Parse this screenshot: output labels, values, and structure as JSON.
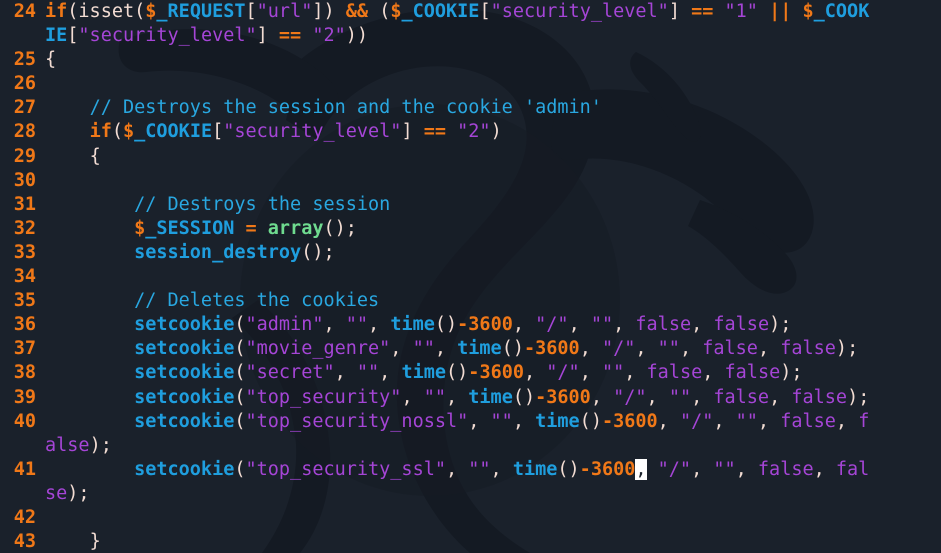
{
  "editor": {
    "name": "php-source-code-viewer",
    "language": "php",
    "background_color": "#1a212b",
    "line_number_color": "#f07818",
    "watermark": "kali-dragon-logo",
    "cursor": {
      "line": 41,
      "highlighted_char": ","
    }
  },
  "palette": {
    "keyword": "#f07818",
    "variable": "#1f9ede",
    "function": "#1f9ede",
    "function_builtin": "#6fdb8f",
    "string": "#a545d6",
    "number": "#f07818",
    "comment": "#29a7e0",
    "punctuation": "#f2dcd3",
    "boolean": "#a545d6",
    "cursor_bg": "#ffffff"
  },
  "lines": [
    {
      "number": "24",
      "tokens": [
        {
          "t": "if",
          "c": "kw"
        },
        {
          "t": "(",
          "c": "punc"
        },
        {
          "t": "isset",
          "c": "plain"
        },
        {
          "t": "(",
          "c": "punc"
        },
        {
          "t": "$",
          "c": "kw"
        },
        {
          "t": "_REQUEST",
          "c": "var"
        },
        {
          "t": "[",
          "c": "punc"
        },
        {
          "t": "\"url\"",
          "c": "str"
        },
        {
          "t": "]",
          "c": "punc"
        },
        {
          "t": ")",
          "c": "punc"
        },
        {
          "t": " ",
          "c": "plain"
        },
        {
          "t": "&&",
          "c": "op"
        },
        {
          "t": " ",
          "c": "plain"
        },
        {
          "t": "(",
          "c": "punc"
        },
        {
          "t": "$",
          "c": "kw"
        },
        {
          "t": "_COOKIE",
          "c": "var"
        },
        {
          "t": "[",
          "c": "punc"
        },
        {
          "t": "\"security_level\"",
          "c": "str"
        },
        {
          "t": "]",
          "c": "punc"
        },
        {
          "t": " ",
          "c": "plain"
        },
        {
          "t": "==",
          "c": "op"
        },
        {
          "t": " ",
          "c": "plain"
        },
        {
          "t": "\"1\"",
          "c": "str"
        },
        {
          "t": " ",
          "c": "plain"
        },
        {
          "t": "||",
          "c": "op"
        },
        {
          "t": " ",
          "c": "plain"
        },
        {
          "t": "$",
          "c": "kw"
        },
        {
          "t": "_COOK",
          "c": "var"
        }
      ]
    },
    {
      "number": "",
      "wrapped": true,
      "tokens": [
        {
          "t": "IE",
          "c": "var"
        },
        {
          "t": "[",
          "c": "punc"
        },
        {
          "t": "\"security_level\"",
          "c": "str"
        },
        {
          "t": "]",
          "c": "punc"
        },
        {
          "t": " ",
          "c": "plain"
        },
        {
          "t": "==",
          "c": "op"
        },
        {
          "t": " ",
          "c": "plain"
        },
        {
          "t": "\"2\"",
          "c": "str"
        },
        {
          "t": ")",
          "c": "punc"
        },
        {
          "t": ")",
          "c": "punc"
        }
      ]
    },
    {
      "number": "25",
      "tokens": [
        {
          "t": "{",
          "c": "punc"
        }
      ]
    },
    {
      "number": "26",
      "tokens": []
    },
    {
      "number": "27",
      "tokens": [
        {
          "t": "    ",
          "c": "plain"
        },
        {
          "t": "// Destroys the session and the cookie 'admin'",
          "c": "cmt"
        }
      ]
    },
    {
      "number": "28",
      "tokens": [
        {
          "t": "    ",
          "c": "plain"
        },
        {
          "t": "if",
          "c": "kw"
        },
        {
          "t": "(",
          "c": "punc"
        },
        {
          "t": "$",
          "c": "kw"
        },
        {
          "t": "_COOKIE",
          "c": "var"
        },
        {
          "t": "[",
          "c": "punc"
        },
        {
          "t": "\"security_level\"",
          "c": "str"
        },
        {
          "t": "]",
          "c": "punc"
        },
        {
          "t": " ",
          "c": "plain"
        },
        {
          "t": "==",
          "c": "op"
        },
        {
          "t": " ",
          "c": "plain"
        },
        {
          "t": "\"2\"",
          "c": "str"
        },
        {
          "t": ")",
          "c": "punc"
        }
      ]
    },
    {
      "number": "29",
      "tokens": [
        {
          "t": "    ",
          "c": "plain"
        },
        {
          "t": "{",
          "c": "punc"
        }
      ]
    },
    {
      "number": "30",
      "tokens": []
    },
    {
      "number": "31",
      "tokens": [
        {
          "t": "        ",
          "c": "plain"
        },
        {
          "t": "// Destroys the session",
          "c": "cmt"
        }
      ]
    },
    {
      "number": "32",
      "tokens": [
        {
          "t": "        ",
          "c": "plain"
        },
        {
          "t": "$",
          "c": "kw"
        },
        {
          "t": "_SESSION",
          "c": "var"
        },
        {
          "t": " ",
          "c": "plain"
        },
        {
          "t": "=",
          "c": "op"
        },
        {
          "t": " ",
          "c": "plain"
        },
        {
          "t": "array",
          "c": "fn2"
        },
        {
          "t": "(",
          "c": "punc"
        },
        {
          "t": ")",
          "c": "punc"
        },
        {
          "t": ";",
          "c": "punc"
        }
      ]
    },
    {
      "number": "33",
      "tokens": [
        {
          "t": "        ",
          "c": "plain"
        },
        {
          "t": "session_destroy",
          "c": "fn"
        },
        {
          "t": "(",
          "c": "punc"
        },
        {
          "t": ")",
          "c": "punc"
        },
        {
          "t": ";",
          "c": "punc"
        }
      ]
    },
    {
      "number": "34",
      "tokens": []
    },
    {
      "number": "35",
      "tokens": [
        {
          "t": "        ",
          "c": "plain"
        },
        {
          "t": "// Deletes the cookies",
          "c": "cmt"
        }
      ]
    },
    {
      "number": "36",
      "tokens": [
        {
          "t": "        ",
          "c": "plain"
        },
        {
          "t": "setcookie",
          "c": "fn"
        },
        {
          "t": "(",
          "c": "punc"
        },
        {
          "t": "\"admin\"",
          "c": "str"
        },
        {
          "t": ", ",
          "c": "punc"
        },
        {
          "t": "\"\"",
          "c": "str"
        },
        {
          "t": ", ",
          "c": "punc"
        },
        {
          "t": "time",
          "c": "fn"
        },
        {
          "t": "(",
          "c": "punc"
        },
        {
          "t": ")",
          "c": "punc"
        },
        {
          "t": "-",
          "c": "op"
        },
        {
          "t": "3600",
          "c": "num"
        },
        {
          "t": ", ",
          "c": "punc"
        },
        {
          "t": "\"/\"",
          "c": "str"
        },
        {
          "t": ", ",
          "c": "punc"
        },
        {
          "t": "\"\"",
          "c": "str"
        },
        {
          "t": ", ",
          "c": "punc"
        },
        {
          "t": "false",
          "c": "bool"
        },
        {
          "t": ", ",
          "c": "punc"
        },
        {
          "t": "false",
          "c": "bool"
        },
        {
          "t": ")",
          "c": "punc"
        },
        {
          "t": ";",
          "c": "punc"
        }
      ]
    },
    {
      "number": "37",
      "tokens": [
        {
          "t": "        ",
          "c": "plain"
        },
        {
          "t": "setcookie",
          "c": "fn"
        },
        {
          "t": "(",
          "c": "punc"
        },
        {
          "t": "\"movie_genre\"",
          "c": "str"
        },
        {
          "t": ", ",
          "c": "punc"
        },
        {
          "t": "\"\"",
          "c": "str"
        },
        {
          "t": ", ",
          "c": "punc"
        },
        {
          "t": "time",
          "c": "fn"
        },
        {
          "t": "(",
          "c": "punc"
        },
        {
          "t": ")",
          "c": "punc"
        },
        {
          "t": "-",
          "c": "op"
        },
        {
          "t": "3600",
          "c": "num"
        },
        {
          "t": ", ",
          "c": "punc"
        },
        {
          "t": "\"/\"",
          "c": "str"
        },
        {
          "t": ", ",
          "c": "punc"
        },
        {
          "t": "\"\"",
          "c": "str"
        },
        {
          "t": ", ",
          "c": "punc"
        },
        {
          "t": "false",
          "c": "bool"
        },
        {
          "t": ", ",
          "c": "punc"
        },
        {
          "t": "false",
          "c": "bool"
        },
        {
          "t": ")",
          "c": "punc"
        },
        {
          "t": ";",
          "c": "punc"
        }
      ]
    },
    {
      "number": "38",
      "tokens": [
        {
          "t": "        ",
          "c": "plain"
        },
        {
          "t": "setcookie",
          "c": "fn"
        },
        {
          "t": "(",
          "c": "punc"
        },
        {
          "t": "\"secret\"",
          "c": "str"
        },
        {
          "t": ", ",
          "c": "punc"
        },
        {
          "t": "\"\"",
          "c": "str"
        },
        {
          "t": ", ",
          "c": "punc"
        },
        {
          "t": "time",
          "c": "fn"
        },
        {
          "t": "(",
          "c": "punc"
        },
        {
          "t": ")",
          "c": "punc"
        },
        {
          "t": "-",
          "c": "op"
        },
        {
          "t": "3600",
          "c": "num"
        },
        {
          "t": ", ",
          "c": "punc"
        },
        {
          "t": "\"/\"",
          "c": "str"
        },
        {
          "t": ", ",
          "c": "punc"
        },
        {
          "t": "\"\"",
          "c": "str"
        },
        {
          "t": ", ",
          "c": "punc"
        },
        {
          "t": "false",
          "c": "bool"
        },
        {
          "t": ", ",
          "c": "punc"
        },
        {
          "t": "false",
          "c": "bool"
        },
        {
          "t": ")",
          "c": "punc"
        },
        {
          "t": ";",
          "c": "punc"
        }
      ]
    },
    {
      "number": "39",
      "tokens": [
        {
          "t": "        ",
          "c": "plain"
        },
        {
          "t": "setcookie",
          "c": "fn"
        },
        {
          "t": "(",
          "c": "punc"
        },
        {
          "t": "\"top_security\"",
          "c": "str"
        },
        {
          "t": ", ",
          "c": "punc"
        },
        {
          "t": "\"\"",
          "c": "str"
        },
        {
          "t": ", ",
          "c": "punc"
        },
        {
          "t": "time",
          "c": "fn"
        },
        {
          "t": "(",
          "c": "punc"
        },
        {
          "t": ")",
          "c": "punc"
        },
        {
          "t": "-",
          "c": "op"
        },
        {
          "t": "3600",
          "c": "num"
        },
        {
          "t": ", ",
          "c": "punc"
        },
        {
          "t": "\"/\"",
          "c": "str"
        },
        {
          "t": ", ",
          "c": "punc"
        },
        {
          "t": "\"\"",
          "c": "str"
        },
        {
          "t": ", ",
          "c": "punc"
        },
        {
          "t": "false",
          "c": "bool"
        },
        {
          "t": ", ",
          "c": "punc"
        },
        {
          "t": "false",
          "c": "bool"
        },
        {
          "t": ")",
          "c": "punc"
        },
        {
          "t": ";",
          "c": "punc"
        }
      ]
    },
    {
      "number": "40",
      "tokens": [
        {
          "t": "        ",
          "c": "plain"
        },
        {
          "t": "setcookie",
          "c": "fn"
        },
        {
          "t": "(",
          "c": "punc"
        },
        {
          "t": "\"top_security_nossl\"",
          "c": "str"
        },
        {
          "t": ", ",
          "c": "punc"
        },
        {
          "t": "\"\"",
          "c": "str"
        },
        {
          "t": ", ",
          "c": "punc"
        },
        {
          "t": "time",
          "c": "fn"
        },
        {
          "t": "(",
          "c": "punc"
        },
        {
          "t": ")",
          "c": "punc"
        },
        {
          "t": "-",
          "c": "op"
        },
        {
          "t": "3600",
          "c": "num"
        },
        {
          "t": ", ",
          "c": "punc"
        },
        {
          "t": "\"/\"",
          "c": "str"
        },
        {
          "t": ", ",
          "c": "punc"
        },
        {
          "t": "\"\"",
          "c": "str"
        },
        {
          "t": ", ",
          "c": "punc"
        },
        {
          "t": "false",
          "c": "bool"
        },
        {
          "t": ", ",
          "c": "punc"
        },
        {
          "t": "f",
          "c": "bool"
        }
      ]
    },
    {
      "number": "",
      "wrapped": true,
      "tokens": [
        {
          "t": "alse",
          "c": "bool"
        },
        {
          "t": ")",
          "c": "punc"
        },
        {
          "t": ";",
          "c": "punc"
        }
      ]
    },
    {
      "number": "41",
      "tokens": [
        {
          "t": "        ",
          "c": "plain"
        },
        {
          "t": "setcookie",
          "c": "fn"
        },
        {
          "t": "(",
          "c": "punc"
        },
        {
          "t": "\"top_security_ssl\"",
          "c": "str"
        },
        {
          "t": ", ",
          "c": "punc"
        },
        {
          "t": "\"\"",
          "c": "str"
        },
        {
          "t": ", ",
          "c": "punc"
        },
        {
          "t": "time",
          "c": "fn"
        },
        {
          "t": "(",
          "c": "punc"
        },
        {
          "t": ")",
          "c": "punc"
        },
        {
          "t": "-",
          "c": "op"
        },
        {
          "t": "3600",
          "c": "num"
        },
        {
          "t": ",",
          "c": "cursor"
        },
        {
          "t": " ",
          "c": "punc"
        },
        {
          "t": "\"/\"",
          "c": "str"
        },
        {
          "t": ", ",
          "c": "punc"
        },
        {
          "t": "\"\"",
          "c": "str"
        },
        {
          "t": ", ",
          "c": "punc"
        },
        {
          "t": "false",
          "c": "bool"
        },
        {
          "t": ", ",
          "c": "punc"
        },
        {
          "t": "fal",
          "c": "bool"
        }
      ]
    },
    {
      "number": "",
      "wrapped": true,
      "tokens": [
        {
          "t": "se",
          "c": "bool"
        },
        {
          "t": ")",
          "c": "punc"
        },
        {
          "t": ";",
          "c": "punc"
        }
      ]
    },
    {
      "number": "42",
      "tokens": []
    },
    {
      "number": "43",
      "tokens": [
        {
          "t": "    ",
          "c": "plain"
        },
        {
          "t": "}",
          "c": "punc"
        }
      ]
    }
  ]
}
